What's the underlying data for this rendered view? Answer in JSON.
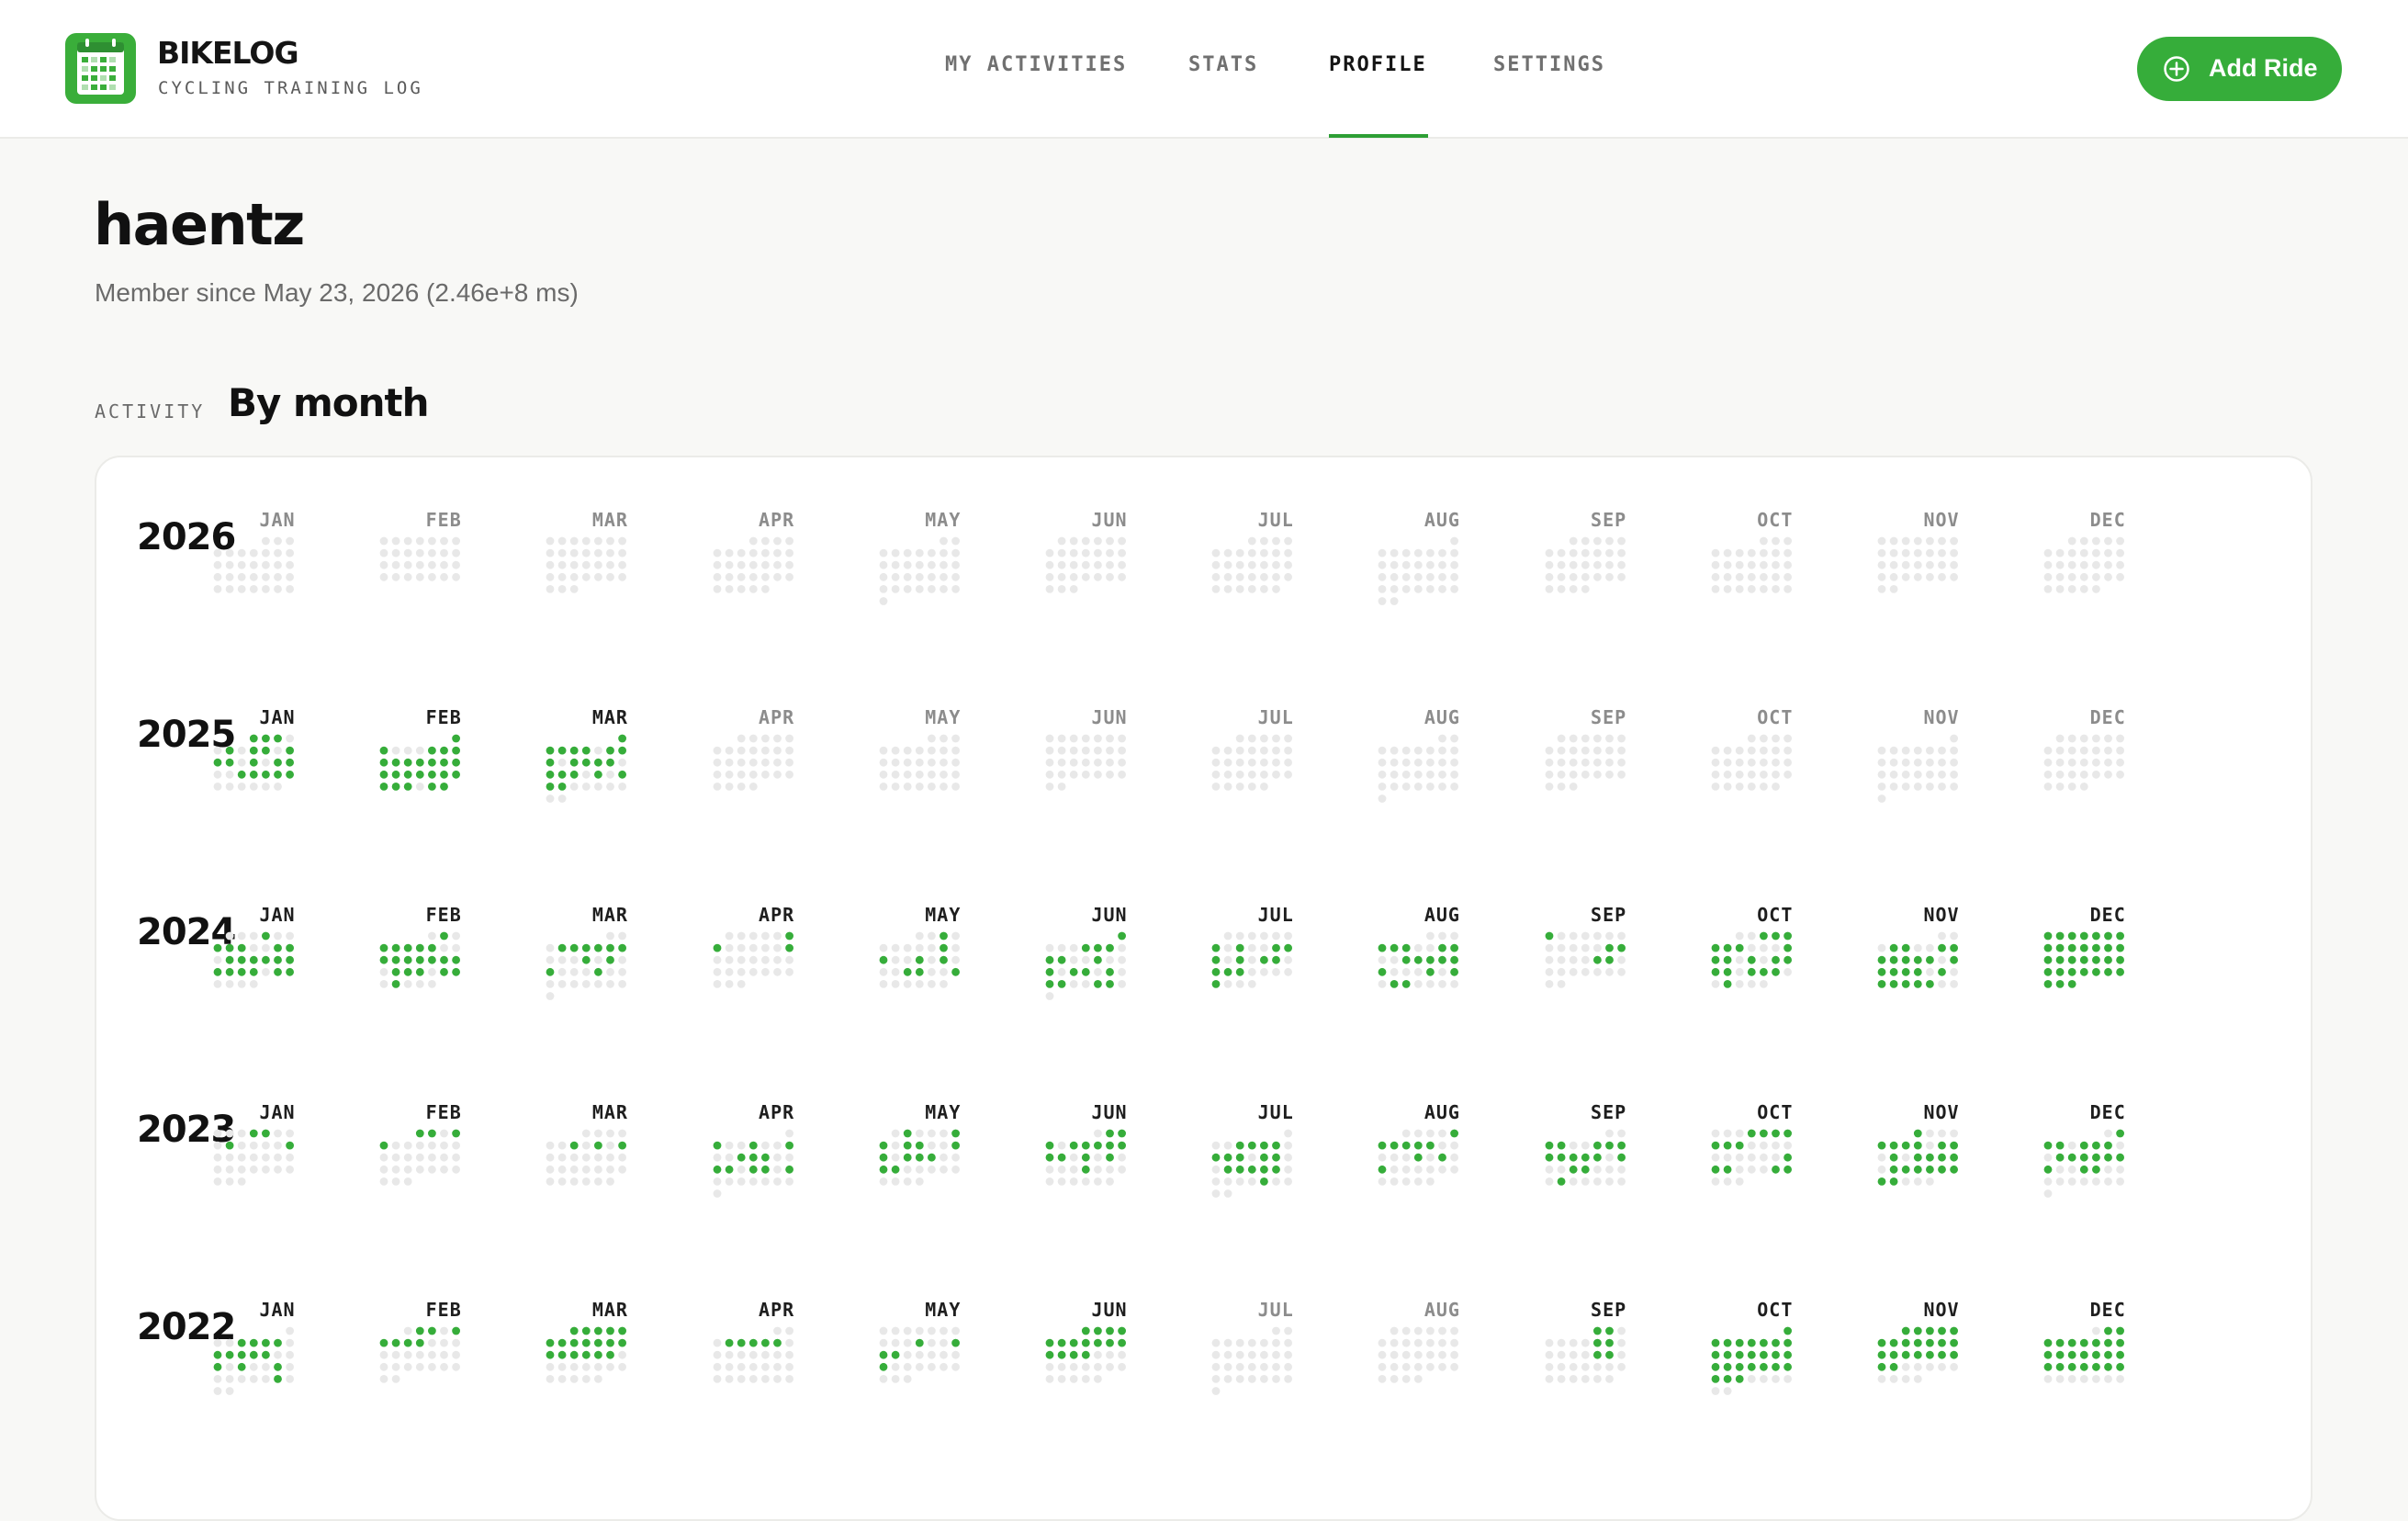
{
  "app": {
    "name": "BIKELOG",
    "tagline": "CYCLING TRAINING LOG",
    "logo_icon": "calendar-grid-icon"
  },
  "nav": {
    "items": [
      {
        "label": "MY ACTIVITIES",
        "active": false
      },
      {
        "label": "STATS",
        "active": false
      },
      {
        "label": "PROFILE",
        "active": true
      },
      {
        "label": "SETTINGS",
        "active": false
      }
    ]
  },
  "actions": {
    "add_ride_label": "Add Ride",
    "add_ride_icon": "plus-circle-icon"
  },
  "profile": {
    "username": "haentz",
    "member_since": "Member since May 23, 2026 (2.46e+8 ms)"
  },
  "activity": {
    "eyebrow": "ACTIVITY",
    "title": "By month",
    "colors": {
      "ride": "#36ad3a",
      "empty": "#e8e8e8"
    },
    "months": [
      "JAN",
      "FEB",
      "MAR",
      "APR",
      "MAY",
      "JUN",
      "JUL",
      "AUG",
      "SEP",
      "OCT",
      "NOV",
      "DEC"
    ],
    "years": [
      {
        "year": "2026",
        "ride_days": [
          [],
          [],
          [],
          [],
          [],
          [],
          [],
          [],
          [],
          [],
          [],
          []
        ]
      },
      {
        "year": "2025",
        "ride_days": [
          [
            1,
            2,
            3,
            6,
            8,
            9,
            11,
            12,
            13,
            15,
            17,
            18,
            21,
            22,
            23,
            24,
            25
          ],
          [
            1,
            2,
            6,
            7,
            8,
            9,
            10,
            11,
            12,
            13,
            14,
            15,
            16,
            17,
            18,
            19,
            20,
            21,
            22,
            23,
            24,
            25,
            27,
            28
          ],
          [
            1,
            2,
            3,
            4,
            5,
            7,
            8,
            9,
            11,
            12,
            13,
            14,
            16,
            17,
            18,
            20,
            22,
            23,
            24
          ],
          [],
          [],
          [],
          [],
          [],
          [],
          [],
          [],
          []
        ]
      },
      {
        "year": "2024",
        "ride_days": [
          [
            4,
            7,
            8,
            9,
            12,
            13,
            15,
            16,
            17,
            18,
            19,
            20,
            21,
            22,
            23,
            24,
            26,
            27
          ],
          [
            2,
            4,
            5,
            6,
            7,
            8,
            11,
            12,
            13,
            14,
            15,
            16,
            17,
            19,
            20,
            21,
            23,
            24,
            26
          ],
          [
            4,
            5,
            6,
            7,
            8,
            9,
            13,
            15,
            17,
            21
          ],
          [
            6,
            7,
            13
          ],
          [
            3,
            10,
            12,
            15,
            17,
            21,
            22,
            25
          ],
          [
            1,
            5,
            6,
            7,
            9,
            10,
            13,
            16,
            18,
            19,
            21,
            23,
            24,
            27,
            28
          ],
          [
            7,
            9,
            12,
            13,
            14,
            16,
            18,
            19,
            21,
            22,
            23,
            28
          ],
          [
            4,
            5,
            6,
            9,
            10,
            13,
            14,
            15,
            16,
            17,
            18,
            22,
            24,
            26,
            27
          ],
          [
            1,
            13,
            14,
            19,
            20
          ],
          [
            3,
            4,
            5,
            6,
            7,
            8,
            12,
            13,
            14,
            16,
            18,
            19,
            20,
            21,
            23,
            24,
            25,
            28
          ],
          [
            4,
            5,
            8,
            9,
            10,
            11,
            12,
            13,
            14,
            16,
            17,
            18,
            19,
            20,
            22,
            24,
            25,
            26,
            27,
            28
          ],
          [
            1,
            2,
            3,
            4,
            5,
            6,
            7,
            8,
            9,
            10,
            11,
            12,
            13,
            14,
            15,
            16,
            17,
            18,
            19,
            20,
            21,
            22,
            23,
            24,
            25,
            26,
            27,
            28,
            29,
            30,
            31
          ]
        ]
      },
      {
        "year": "2023",
        "ride_days": [
          [
            4,
            5,
            9,
            14
          ],
          [
            1,
            2,
            4,
            5
          ],
          [
            7,
            9,
            11
          ],
          [
            2,
            5,
            8,
            11,
            12,
            13,
            16,
            17,
            19,
            20,
            22
          ],
          [
            2,
            6,
            7,
            9,
            10,
            13,
            14,
            16,
            17,
            18,
            21,
            22
          ],
          [
            2,
            3,
            4,
            6,
            7,
            8,
            9,
            10,
            11,
            12,
            14,
            16,
            21
          ],
          [
            4,
            5,
            6,
            7,
            9,
            10,
            11,
            13,
            14,
            17,
            18,
            19,
            20,
            21,
            27
          ],
          [
            5,
            6,
            7,
            8,
            9,
            10,
            16,
            18,
            20
          ],
          [
            3,
            4,
            7,
            8,
            9,
            10,
            11,
            12,
            13,
            14,
            16,
            19,
            20,
            25
          ],
          [
            4,
            5,
            6,
            7,
            8,
            9,
            10,
            21,
            22,
            23,
            27,
            28
          ],
          [
            1,
            5,
            6,
            7,
            8,
            10,
            11,
            13,
            15,
            16,
            17,
            18,
            20,
            21,
            22,
            23,
            24,
            25,
            26,
            27
          ],
          [
            2,
            3,
            4,
            6,
            7,
            8,
            11,
            12,
            13,
            14,
            15,
            16,
            17,
            20,
            21
          ]
        ]
      },
      {
        "year": "2022",
        "ride_days": [
          [
            4,
            5,
            6,
            7,
            9,
            10,
            11,
            12,
            13,
            16,
            18,
            21,
            28
          ],
          [
            2,
            3,
            5,
            6,
            7,
            8,
            9
          ],
          [
            1,
            2,
            3,
            4,
            5,
            6,
            7,
            8,
            9,
            10,
            11,
            12,
            13,
            14,
            15,
            16,
            17,
            18
          ],
          [
            4,
            5,
            6,
            7,
            8
          ],
          [
            11,
            14,
            15,
            16,
            22
          ],
          [
            1,
            2,
            3,
            4,
            5,
            6,
            7,
            8,
            9,
            10,
            11,
            12,
            13,
            14,
            15
          ],
          [],
          [],
          [
            1,
            2,
            8,
            9,
            15,
            16
          ],
          [
            1,
            2,
            3,
            4,
            5,
            6,
            7,
            8,
            9,
            10,
            11,
            12,
            13,
            14,
            15,
            16,
            17,
            18,
            19,
            20,
            21,
            22,
            23,
            24,
            25
          ],
          [
            1,
            2,
            3,
            4,
            5,
            6,
            7,
            8,
            9,
            10,
            11,
            12,
            13,
            14,
            15,
            16,
            17,
            18,
            19,
            20,
            21
          ],
          [
            2,
            3,
            4,
            5,
            6,
            7,
            8,
            9,
            10,
            11,
            12,
            13,
            14,
            15,
            16,
            17,
            18,
            19,
            20,
            21,
            22,
            23,
            24
          ]
        ]
      }
    ]
  }
}
